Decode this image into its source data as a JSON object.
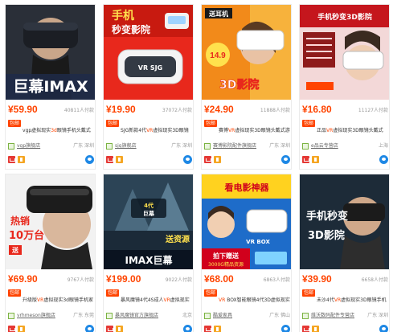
{
  "products": [
    {
      "image_text": [
        "巨幕IMAX"
      ],
      "price": "¥59.90",
      "sold": "40811人付款",
      "tag": "包邮",
      "title_pre": "vgp虚拟现实",
      "title_hl": "3d",
      "title_post": "眼镜手机头戴式影院游戏头盔暴",
      "shop": "vgp旗舰店",
      "location": "广东 深圳"
    },
    {
      "image_text": [
        "手机",
        "秒变影院",
        "VR SJG"
      ],
      "price": "¥19.90",
      "sold": "37072人付款",
      "tag": "包邮",
      "title_pre": "SJG新款4代",
      "title_hl": "VR",
      "title_post": "虚拟现实3D眼镜头戴式影院手机视频智能头",
      "shop": "sjg旗舰店",
      "location": "广东 深圳"
    },
    {
      "image_text": [
        "送耳机",
        "14.9",
        "3D影院"
      ],
      "price": "¥24.90",
      "sold": "11888人付款",
      "tag": "包邮",
      "title_pre": "赛博",
      "title_hl": "VR",
      "title_post": "虚拟现实3D眼镜头戴式游戏头盔4代智",
      "shop": "赛博影院配件旗舰店",
      "location": "广东 深圳"
    },
    {
      "image_text": [
        "手机秒变3D影院"
      ],
      "price": "¥16.80",
      "sold": "11127人付款",
      "tag": "包邮",
      "title_pre": "正品",
      "title_hl": "VR",
      "title_post": "虚拟现实3D眼镜头戴式Box+手机3D影院游戏手",
      "shop": "e品云专营店",
      "location": "上海"
    },
    {
      "image_text": [
        "热销",
        "10万台",
        "送"
      ],
      "price": "¥69.90",
      "sold": "9767人付款",
      "tag": "包邮",
      "title_pre": "升级版",
      "title_hl": "VR",
      "title_post": "虚拟现实3d眼镜手机家用影院游戏机BOX",
      "shop": "vrhmeson旗舰店",
      "location": "广东 东莞"
    },
    {
      "image_text": [
        "4代",
        "巨幕",
        "IMAX巨幕",
        "送资源"
      ],
      "price": "¥199.00",
      "sold": "9022人付款",
      "tag": "包邮",
      "title_pre": "暴风魔镜4代4S成人",
      "title_hl": "VR",
      "title_post": "虚拟现实眼镜3D影院头戴式智能手机",
      "shop": "暴风魔镜官方旗舰店",
      "location": "北京"
    },
    {
      "image_text": [
        "看电影神器",
        "拍下赠送",
        "3000G精品资源",
        "VR BOX"
      ],
      "price": "¥68.00",
      "sold": "6863人付款",
      "tag": "包邮",
      "title_pre": "",
      "title_hl": "VR",
      "title_post": " BOX智能眼镜4代3D虚拟现实头戴式游",
      "shop": "酷爱家具",
      "location": "广东 佛山"
    },
    {
      "image_text": [
        "手机秒变",
        "3D影院"
      ],
      "price": "¥39.90",
      "sold": "6658人付款",
      "tag": "包邮",
      "title_pre": "未沙4代",
      "title_hl": "VR",
      "title_post": "虚拟现实3D眼镜手机影院苹果头戴式游戏4",
      "shop": "维沃数码配件专营店",
      "location": "广东 深圳"
    }
  ],
  "colors": {
    "price": "#ff4400",
    "tag_bg": "#ff4400",
    "shop_icon": "#7cb342",
    "brand_badge": "#e53935",
    "store_badge": "#f5a623",
    "chat": "#1e88e5"
  },
  "icons": [
    "vr-headset-icon",
    "tmall-badge-icon",
    "store-badge-icon",
    "wangwang-chat-icon",
    "shop-icon"
  ]
}
